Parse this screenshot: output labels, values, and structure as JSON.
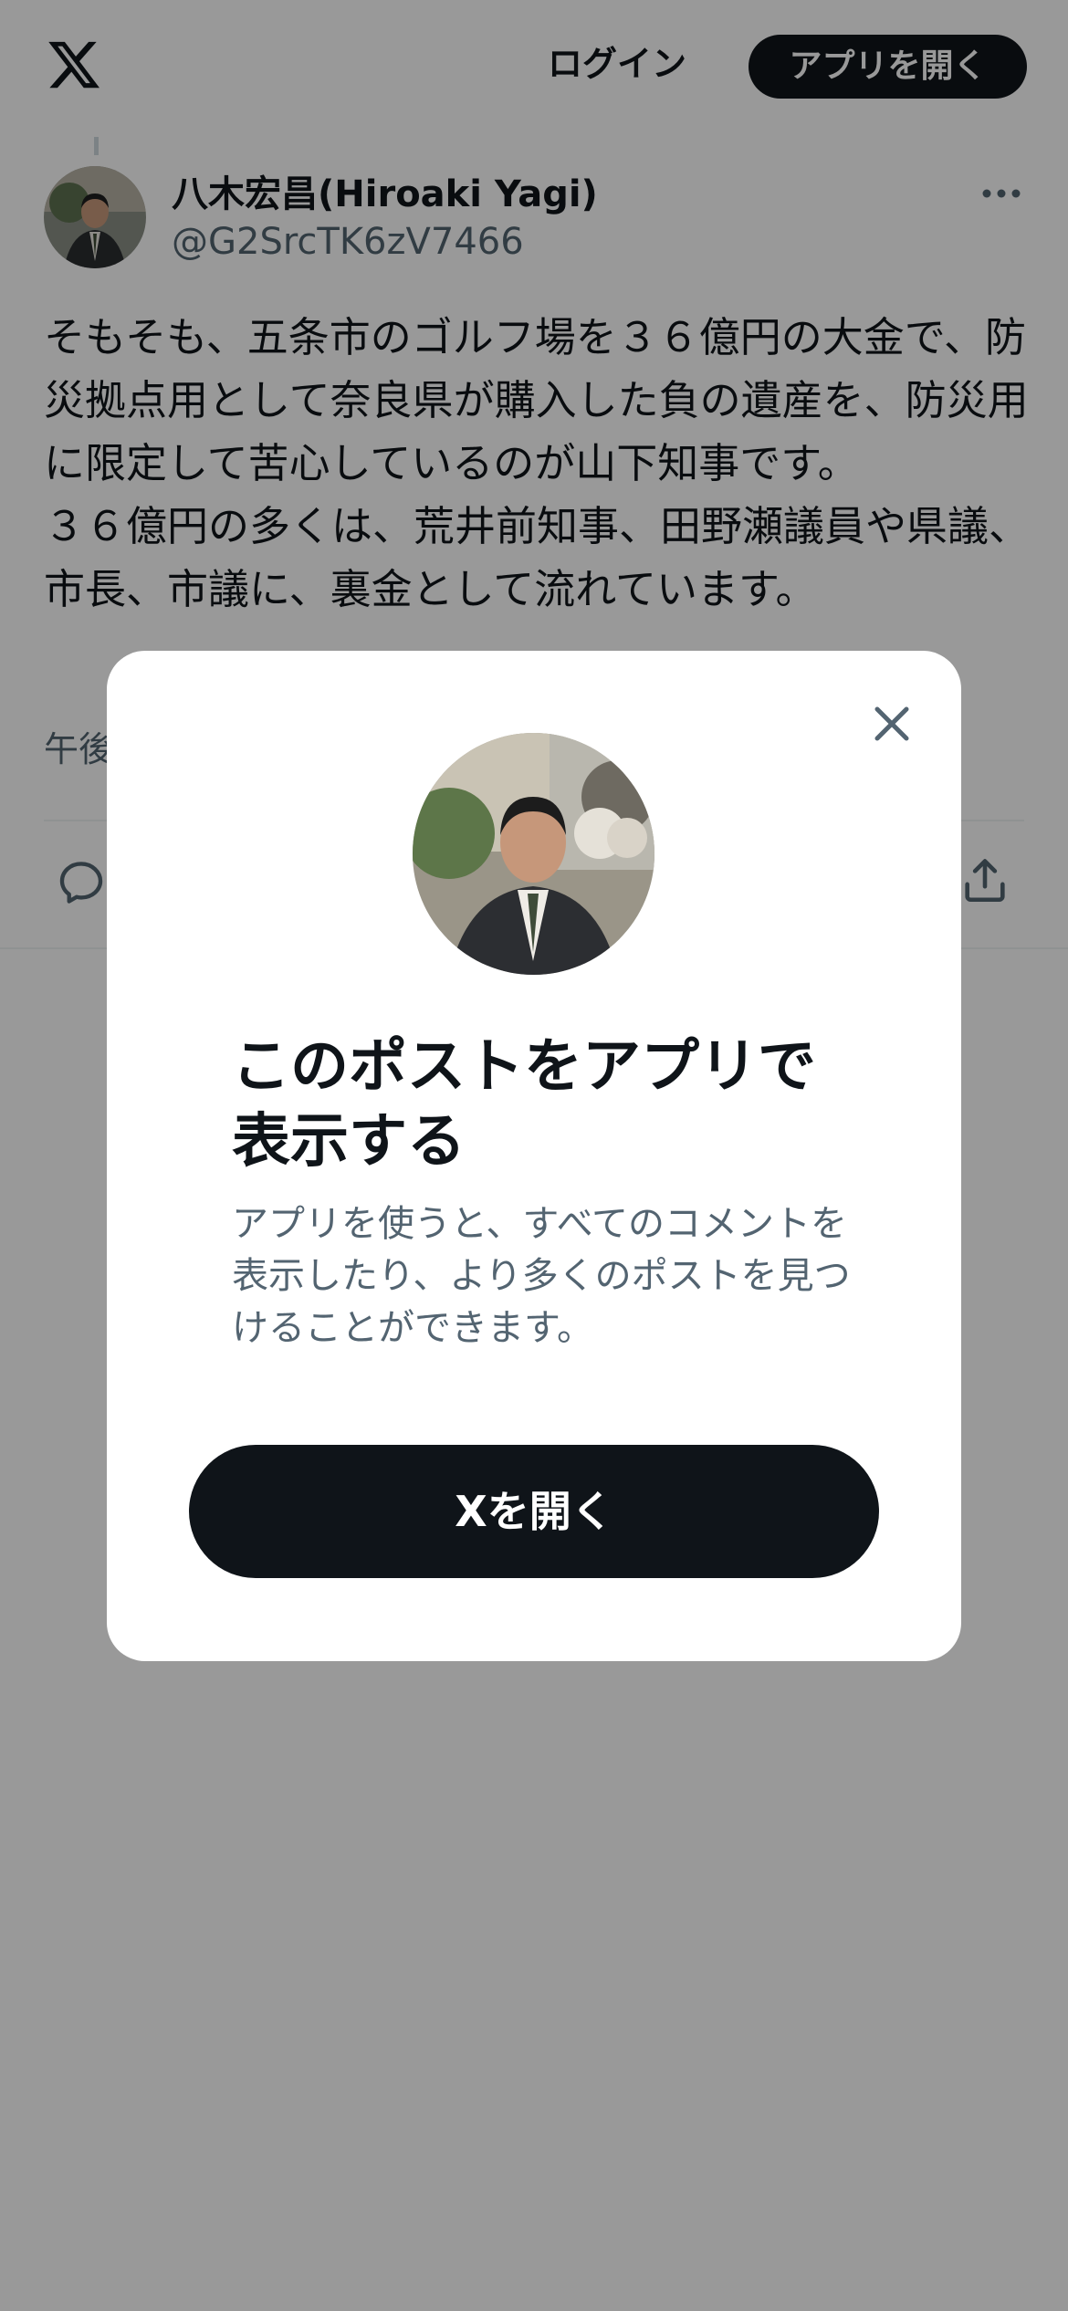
{
  "header": {
    "logo_icon": "x-logo-icon",
    "login_label": "ログイン",
    "open_app_label": "アプリを開く"
  },
  "post": {
    "author_name": "八木宏昌(Hiroaki Yagi)",
    "author_handle": "@G2SrcTK6zV7466",
    "text": "そもそも、五条市のゴルフ場を３６億円の大金で、防災拠点用として奈良県が購入した負の遺産を、防災用に限定して苦心しているのが山下知事です。\n３６億円の多くは、荒井前知事、田野瀬議員や県議、市長、市議に、裏金として流れています。",
    "timestamp": "午後",
    "actions": [
      "reply-icon",
      "share-icon"
    ]
  },
  "modal": {
    "close_icon": "close-icon",
    "title": "このポストをアプリで表示する",
    "description": "アプリを使うと、すべてのコメントを表示したり、より多くのポストを見つけることができます。",
    "button_label": "Xを開く"
  },
  "colors": {
    "text_primary": "#0f1419",
    "text_secondary": "#536471",
    "button_bg": "#0f1419",
    "overlay": "rgba(0,0,0,0.4)"
  }
}
